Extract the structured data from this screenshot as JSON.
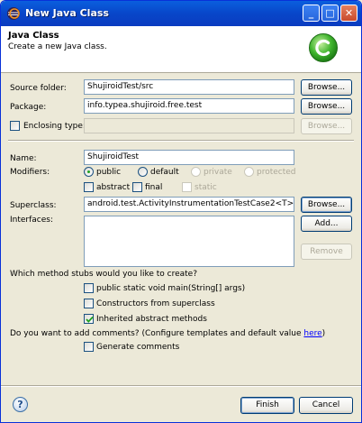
{
  "window": {
    "title": "New Java Class"
  },
  "header": {
    "title": "Java Class",
    "description": "Create a new Java class."
  },
  "source_folder": {
    "label": "Source folder:",
    "value": "ShujiroidTest/src",
    "browse": "Browse..."
  },
  "package": {
    "label": "Package:",
    "value": "info.typea.shujiroid.free.test",
    "browse": "Browse..."
  },
  "enclosing": {
    "label": "Enclosing type:",
    "value": "",
    "browse": "Browse...",
    "checked": false
  },
  "name": {
    "label": "Name:",
    "value": "ShujiroidTest"
  },
  "modifiers": {
    "label": "Modifiers:",
    "public": "public",
    "default": "default",
    "private": "private",
    "protected": "protected",
    "abstract": "abstract",
    "final": "final",
    "static": "static",
    "selected": "public"
  },
  "superclass": {
    "label": "Superclass:",
    "value": "android.test.ActivityInstrumentationTestCase2<T>",
    "browse": "Browse..."
  },
  "interfaces": {
    "label": "Interfaces:",
    "add": "Add...",
    "remove": "Remove"
  },
  "stubs": {
    "question": "Which method stubs would you like to create?",
    "main": "public static void main(String[] args)",
    "constructors": "Constructors from superclass",
    "inherited": "Inherited abstract methods",
    "main_checked": false,
    "constructors_checked": false,
    "inherited_checked": true
  },
  "comments": {
    "question": "Do you want to add comments? (Configure templates and default value ",
    "link": "here",
    "close": ")",
    "generate": "Generate comments",
    "checked": false
  },
  "footer": {
    "finish": "Finish",
    "cancel": "Cancel"
  },
  "colors": {
    "titlebar": "#0846c9",
    "check": "#21a121",
    "dialog_bg": "#ece9d8"
  }
}
